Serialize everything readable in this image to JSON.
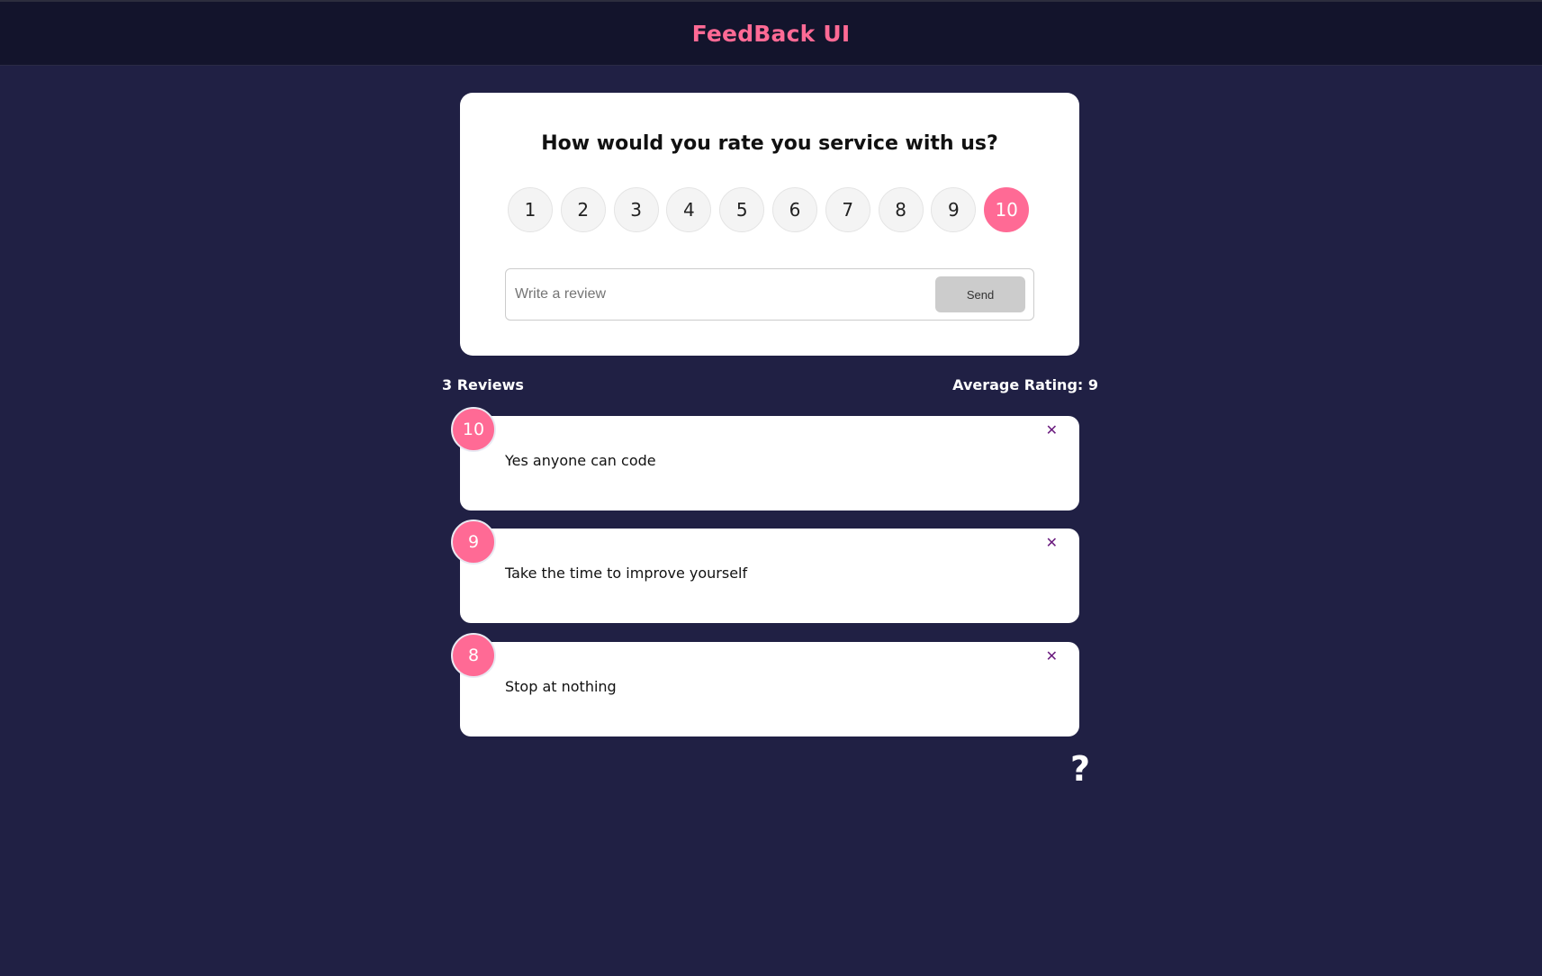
{
  "header": {
    "title": "FeedBack UI"
  },
  "rating_card": {
    "question": "How would you rate you service with us?",
    "options": [
      "1",
      "2",
      "3",
      "4",
      "5",
      "6",
      "7",
      "8",
      "9",
      "10"
    ],
    "selected": "10",
    "review_placeholder": "Write a review",
    "review_value": "",
    "send_label": "Send"
  },
  "stats": {
    "count_label": "3 Reviews",
    "average_label": "Average Rating: 9"
  },
  "feedback": [
    {
      "rating": "10",
      "text": "Yes anyone can code",
      "close": "✕"
    },
    {
      "rating": "9",
      "text": "Take the time to improve yourself",
      "close": "✕"
    },
    {
      "rating": "8",
      "text": "Stop at nothing",
      "close": "✕"
    }
  ],
  "help": {
    "icon": "question-icon",
    "glyph": "?"
  },
  "colors": {
    "background": "#202044",
    "accent": "#ff6a95",
    "header": "#13142c",
    "close": "#6a1b7e"
  }
}
